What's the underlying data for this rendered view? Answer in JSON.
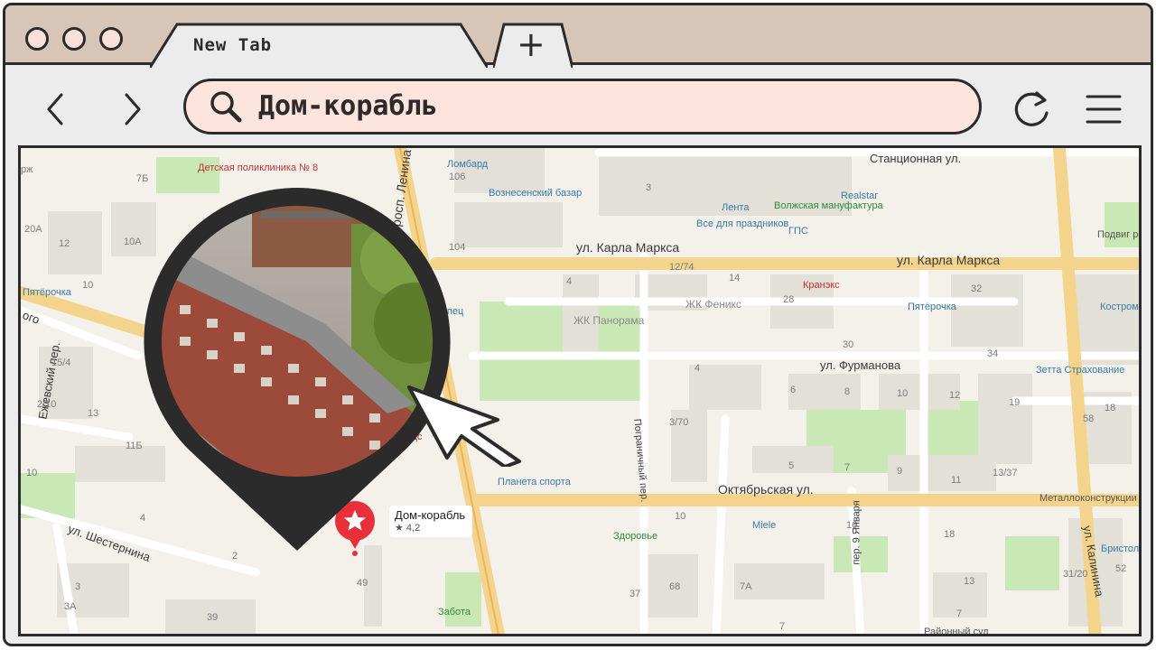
{
  "browser": {
    "tab_title": "New Tab",
    "new_tab_symbol": "+",
    "search_query": "Дом-корабль",
    "icons": {
      "back": "chevron-left-icon",
      "forward": "chevron-right-icon",
      "search": "search-icon",
      "reload": "reload-icon",
      "menu": "hamburger-menu-icon"
    },
    "colors": {
      "tab_strip": "#d7c5b7",
      "omnibox": "#fde4dc",
      "outline": "#2b2b2b"
    }
  },
  "map": {
    "streets": [
      "Станционная ул.",
      "ул. Карла Маркса",
      "ул. Карла Маркса",
      "ул. Фурманова",
      "Октябрьская ул.",
      "ул. Шестернина",
      "Пограничный пер.",
      "пер. 9 Января",
      "ул. Калинина",
      "просп. Ленина",
      "Ежевский пер.",
      "ого"
    ],
    "pois": [
      "Детская поликлиника № 8",
      "Ломбард",
      "Вознесенский базар",
      "Лента",
      "Волжская мануфактура",
      "Realstar",
      "Все для праздников",
      "ГПС",
      "Пятёрочка",
      "Купец",
      "ЖК Панорама",
      "ЖК Феникс",
      "Кранэкс",
      "Пятёрочка",
      "Кострома ювелирный",
      "Зетта Страхование",
      "Планета спорта",
      "Здоровье",
      "Miele",
      "Металлоконструкции",
      "Бристоль",
      "Забота",
      "Районный суд",
      "Подвиг революции",
      "алдс"
    ],
    "house_numbers": [
      "7Б",
      "20А",
      "12",
      "10А",
      "10",
      "15/4",
      "2/10",
      "13",
      "11Б",
      "10",
      "4",
      "2",
      "3",
      "3А",
      "39",
      "49",
      "106",
      "104",
      "3",
      "12/74",
      "14",
      "28",
      "4",
      "32",
      "30",
      "34",
      "4",
      "6",
      "8",
      "10",
      "12",
      "19",
      "18",
      "58",
      "3/70",
      "5",
      "7",
      "9",
      "11",
      "13/37",
      "10",
      "16",
      "18",
      "37",
      "68",
      "7А",
      "7",
      "13",
      "31/20",
      "52",
      "7"
    ],
    "pin": {
      "name": "Дом-корабль",
      "rating": "★ 4,2"
    },
    "photo_subject": "ship-house-building-photo",
    "colors": {
      "road_major": "#f4d48c",
      "road_minor": "#ffffff",
      "park": "#c9e8b5",
      "building": "#e6e3dc",
      "background": "#f3f1ea",
      "pin": "#e8303a"
    }
  }
}
